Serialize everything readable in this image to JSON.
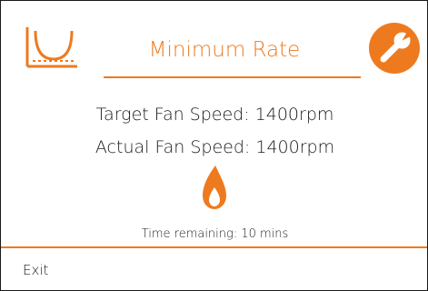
{
  "header": {
    "title": "Minimum Rate",
    "mode_icon": "minimum-rate-curve-icon",
    "service_icon": "wrench-icon"
  },
  "status": {
    "target_fan_speed": "Target Fan Speed: 1400rpm",
    "actual_fan_speed": "Actual Fan Speed: 1400rpm",
    "flame_icon": "flame-icon",
    "time_remaining": "Time remaining: 10 mins"
  },
  "footer": {
    "exit_label": "Exit"
  },
  "colors": {
    "accent": "#ee7a1f",
    "text": "#1a1a1a",
    "background": "#ffffff"
  }
}
